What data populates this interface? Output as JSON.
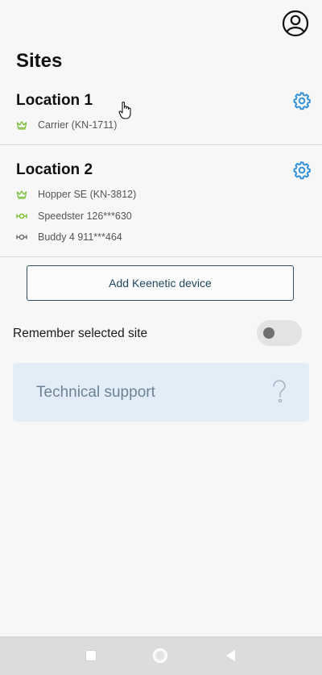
{
  "header": {
    "title": "Sites",
    "profile_icon": "user-circle-icon"
  },
  "sites": [
    {
      "name": "Location 1",
      "settings_icon": "gear-icon",
      "devices": [
        {
          "label": "Carrier (KN-1711)",
          "icon": "crown-icon",
          "icon_color": "#7cbf3a"
        }
      ]
    },
    {
      "name": "Location 2",
      "settings_icon": "gear-icon",
      "devices": [
        {
          "label": "Hopper SE (KN-3812)",
          "icon": "crown-icon",
          "icon_color": "#7cbf3a"
        },
        {
          "label": "Speedster 126***630",
          "icon": "node-link-icon",
          "icon_color": "#7cbf3a"
        },
        {
          "label": "Buddy 4 911***464",
          "icon": "node-link-icon",
          "icon_color": "#6a6a6a"
        }
      ]
    }
  ],
  "actions": {
    "add_device_label": "Add Keenetic device"
  },
  "settings": {
    "remember_label": "Remember selected site",
    "remember_enabled": false
  },
  "support": {
    "label": "Technical support",
    "icon": "question-icon"
  },
  "colors": {
    "accent": "#2f8fd8",
    "online": "#7cbf3a",
    "offline": "#6a6a6a",
    "support_bg": "#e3edf7"
  },
  "navigation": {
    "buttons": [
      "square-icon",
      "circle-icon",
      "back-triangle-icon"
    ]
  }
}
